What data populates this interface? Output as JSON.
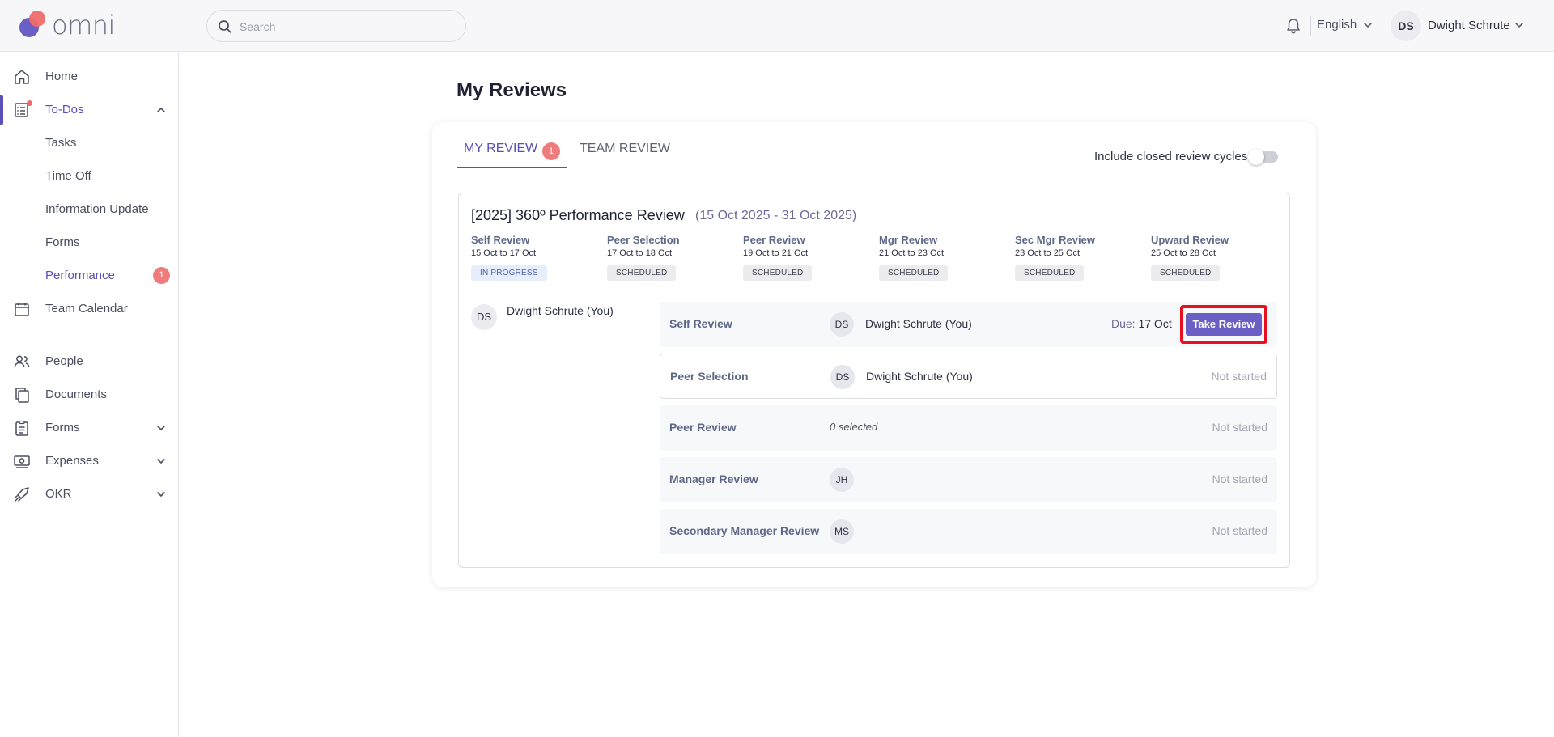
{
  "app": {
    "logo_text": "omni"
  },
  "header": {
    "search_placeholder": "Search",
    "language": "English",
    "user_initials": "DS",
    "user_name": "Dwight Schrute"
  },
  "sidebar": {
    "home": "Home",
    "todos": "To-Dos",
    "todo_sub": [
      "Tasks",
      "Time Off",
      "Information Update",
      "Forms",
      "Performance"
    ],
    "performance_badge": "1",
    "team_calendar": "Team Calendar",
    "people": "People",
    "documents": "Documents",
    "forms": "Forms",
    "expenses": "Expenses",
    "okr": "OKR"
  },
  "page": {
    "title": "My Reviews",
    "tabs": [
      {
        "label": "MY REVIEW",
        "badge": "1",
        "active": true
      },
      {
        "label": "TEAM REVIEW",
        "active": false
      }
    ],
    "include_closed_label": "Include closed review cycles",
    "include_closed_on": false
  },
  "cycle": {
    "title": "[2025] 360º Performance Review",
    "dates": "(15 Oct 2025 - 31 Oct 2025)",
    "stages": [
      {
        "name": "Self Review",
        "dates": "15 Oct to 17 Oct",
        "status": "IN PROGRESS"
      },
      {
        "name": "Peer Selection",
        "dates": "17 Oct to 18 Oct",
        "status": "SCHEDULED"
      },
      {
        "name": "Peer Review",
        "dates": "19 Oct to 21 Oct",
        "status": "SCHEDULED"
      },
      {
        "name": "Mgr Review",
        "dates": "21 Oct to 23 Oct",
        "status": "SCHEDULED"
      },
      {
        "name": "Sec Mgr Review",
        "dates": "23 Oct to 25 Oct",
        "status": "SCHEDULED"
      },
      {
        "name": "Upward Review",
        "dates": "25 Oct to 28 Oct",
        "status": "SCHEDULED"
      }
    ],
    "employee": {
      "initials": "DS",
      "name": "Dwight Schrute (You)"
    },
    "rows": [
      {
        "label": "Self Review",
        "avatar": "DS",
        "name": "Dwight Schrute (You)",
        "due_label": "Due:",
        "due_value": "17 Oct",
        "action": "Take Review"
      },
      {
        "label": "Peer Selection",
        "avatar": "DS",
        "name": "Dwight Schrute (You)",
        "status": "Not started"
      },
      {
        "label": "Peer Review",
        "selected": "0 selected",
        "status": "Not started"
      },
      {
        "label": "Manager Review",
        "avatar": "JH",
        "status": "Not started"
      },
      {
        "label": "Secondary Manager Review",
        "avatar": "MS",
        "status": "Not started"
      }
    ]
  }
}
